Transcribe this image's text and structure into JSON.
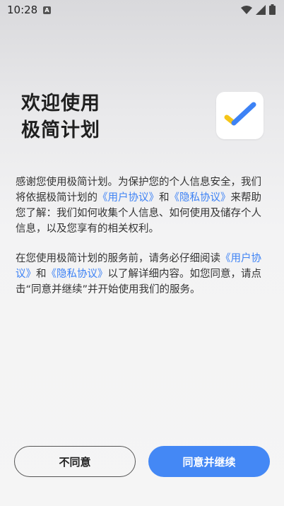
{
  "status_bar": {
    "time": "10:28",
    "notification_icon": "A"
  },
  "header": {
    "title_line1": "欢迎使用",
    "title_line2": "极简计划"
  },
  "content": {
    "p1_part1": "感谢您使用极简计划。为保护您的个人信息安全，我们将依据极简计划的",
    "p1_link1": "《用户协议》",
    "p1_and": "和",
    "p1_link2": "《隐私协议》",
    "p1_part2": "来帮助您了解：我们如何收集个人信息、如何使用及储存个人信息，以及您享有的相关权利。",
    "p2_part1": "在您使用极简计划的服务前，请务必仔细阅读",
    "p2_link1": "《用户协议》",
    "p2_and": "和",
    "p2_link2": "《隐私协议》",
    "p2_part2": "以了解详细内容。如您同意，请点击“同意并继续”并开始使用我们的服务。"
  },
  "buttons": {
    "disagree_label": "不同意",
    "agree_label": "同意并继续"
  },
  "colors": {
    "accent": "#4488f5",
    "link": "#3d82f5",
    "check_yellow": "#f5c518"
  },
  "icons": {
    "app": "check-mark-app-icon",
    "wifi": "wifi-icon",
    "signal": "signal-icon",
    "battery": "battery-icon"
  }
}
